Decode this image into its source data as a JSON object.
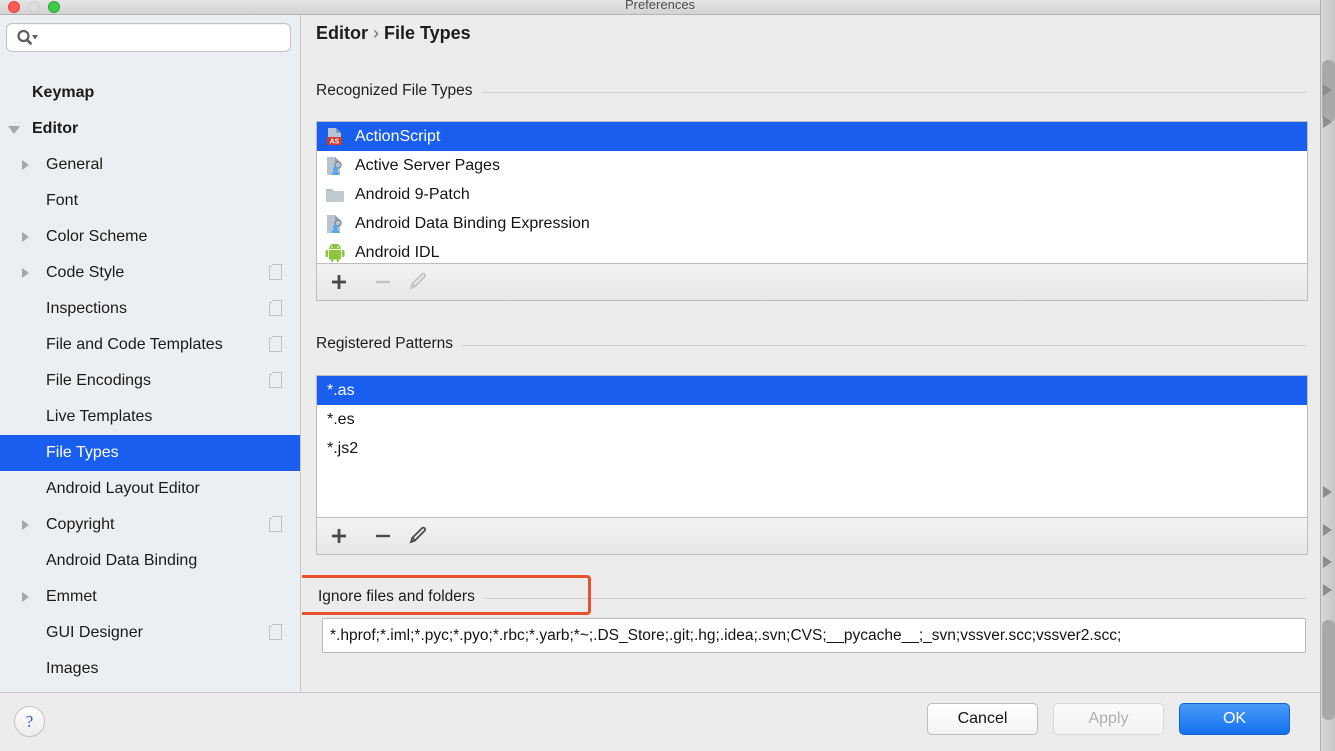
{
  "window": {
    "title": "Preferences",
    "controls": [
      "close",
      "minimize",
      "maximize"
    ]
  },
  "sidebar": {
    "search": {
      "value": "",
      "placeholder": "",
      "icon": "search-icon"
    },
    "items": [
      {
        "label": "",
        "indent": 14,
        "twisty": "none",
        "bold": false,
        "selected": false,
        "copy": false,
        "partial": true
      },
      {
        "label": "Keymap",
        "indent": 32,
        "twisty": "none",
        "bold": true,
        "selected": false,
        "copy": false
      },
      {
        "label": "Editor",
        "indent": 32,
        "twisty": "open",
        "bold": true,
        "selected": false,
        "copy": false
      },
      {
        "label": "General",
        "indent": 46,
        "twisty": "closed",
        "bold": false,
        "selected": false,
        "copy": false
      },
      {
        "label": "Font",
        "indent": 46,
        "twisty": "none",
        "bold": false,
        "selected": false,
        "copy": false
      },
      {
        "label": "Color Scheme",
        "indent": 46,
        "twisty": "closed",
        "bold": false,
        "selected": false,
        "copy": false
      },
      {
        "label": "Code Style",
        "indent": 46,
        "twisty": "closed",
        "bold": false,
        "selected": false,
        "copy": true
      },
      {
        "label": "Inspections",
        "indent": 46,
        "twisty": "none",
        "bold": false,
        "selected": false,
        "copy": true
      },
      {
        "label": "File and Code Templates",
        "indent": 46,
        "twisty": "none",
        "bold": false,
        "selected": false,
        "copy": true
      },
      {
        "label": "File Encodings",
        "indent": 46,
        "twisty": "none",
        "bold": false,
        "selected": false,
        "copy": true
      },
      {
        "label": "Live Templates",
        "indent": 46,
        "twisty": "none",
        "bold": false,
        "selected": false,
        "copy": false
      },
      {
        "label": "File Types",
        "indent": 46,
        "twisty": "none",
        "bold": false,
        "selected": true,
        "copy": false
      },
      {
        "label": "Android Layout Editor",
        "indent": 46,
        "twisty": "none",
        "bold": false,
        "selected": false,
        "copy": false
      },
      {
        "label": "Copyright",
        "indent": 46,
        "twisty": "closed",
        "bold": false,
        "selected": false,
        "copy": true
      },
      {
        "label": "Android Data Binding",
        "indent": 46,
        "twisty": "none",
        "bold": false,
        "selected": false,
        "copy": false
      },
      {
        "label": "Emmet",
        "indent": 46,
        "twisty": "closed",
        "bold": false,
        "selected": false,
        "copy": false
      },
      {
        "label": "GUI Designer",
        "indent": 46,
        "twisty": "none",
        "bold": false,
        "selected": false,
        "copy": true
      },
      {
        "label": "Images",
        "indent": 46,
        "twisty": "none",
        "bold": false,
        "selected": false,
        "copy": false
      }
    ]
  },
  "content": {
    "breadcrumb": {
      "parent": "Editor",
      "separator": "›",
      "current": "File Types"
    },
    "recognized": {
      "section_label": "Recognized File Types",
      "rows": [
        {
          "label": "ActionScript",
          "icon": "actionscript-file-icon",
          "selected": true
        },
        {
          "label": "Active Server Pages",
          "icon": "asp-file-icon",
          "selected": false
        },
        {
          "label": "Android 9-Patch",
          "icon": "folder-icon",
          "selected": false
        },
        {
          "label": "Android Data Binding Expression",
          "icon": "asp-file-icon",
          "selected": false
        },
        {
          "label": "Android IDL",
          "icon": "android-icon",
          "selected": false
        }
      ],
      "toolbar": [
        {
          "name": "add-file-type-button",
          "icon": "plus-icon",
          "enabled": true
        },
        {
          "name": "remove-file-type-button",
          "icon": "minus-icon",
          "enabled": false
        },
        {
          "name": "edit-file-type-button",
          "icon": "pencil-icon",
          "enabled": false
        }
      ]
    },
    "patterns": {
      "section_label": "Registered Patterns",
      "rows": [
        {
          "label": "*.as",
          "selected": true
        },
        {
          "label": "*.es",
          "selected": false
        },
        {
          "label": "*.js2",
          "selected": false
        }
      ],
      "toolbar": [
        {
          "name": "add-pattern-button",
          "icon": "plus-icon",
          "enabled": true
        },
        {
          "name": "remove-pattern-button",
          "icon": "minus-icon",
          "enabled": true
        },
        {
          "name": "edit-pattern-button",
          "icon": "pencil-icon",
          "enabled": true
        }
      ]
    },
    "ignore": {
      "section_label": "Ignore files and folders",
      "value": "*.hprof;*.iml;*.pyc;*.pyo;*.rbc;*.yarb;*~;.DS_Store;.git;.hg;.idea;.svn;CVS;__pycache__;_svn;vssver.scc;vssver2.scc;",
      "highlight_color": "#e8512b"
    }
  },
  "footer": {
    "help_label": "?",
    "cancel_label": "Cancel",
    "apply_label": "Apply",
    "ok_label": "OK",
    "apply_enabled": false
  },
  "theme": {
    "selection_blue": "#1a5ef0",
    "ok_blue": "#1371ef",
    "sidebar_bg": "#eceff1",
    "content_bg": "#ececec"
  }
}
